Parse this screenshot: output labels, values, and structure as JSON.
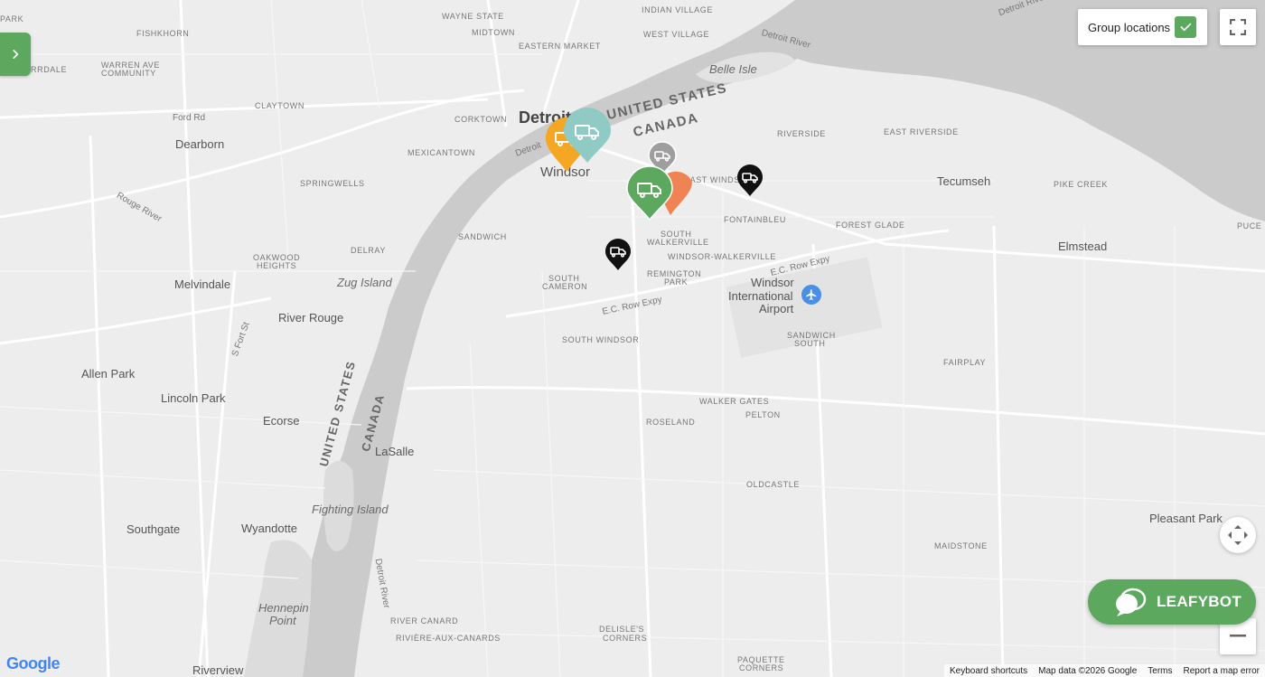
{
  "map": {
    "place_labels": [
      {
        "text": "PARK",
        "cls": "sm"
      },
      {
        "text": "WAYNE STATE",
        "cls": "sm"
      },
      {
        "text": "INDIAN VILLAGE",
        "cls": "sm"
      },
      {
        "text": "FISHKHORN",
        "cls": "sm"
      },
      {
        "text": "MIDTOWN",
        "cls": "sm"
      },
      {
        "text": "WEST VILLAGE",
        "cls": "sm"
      },
      {
        "text": "EASTERN MARKET",
        "cls": "sm"
      },
      {
        "text": "Belle Isle",
        "cls": "md it"
      },
      {
        "text": "RRDALE",
        "cls": "sm"
      },
      {
        "text": "WARREN AVE",
        "cls": "sm"
      },
      {
        "text": "COMMUNITY",
        "cls": "sm"
      },
      {
        "text": "CLAYTOWN",
        "cls": "sm"
      },
      {
        "text": "Ford Rd",
        "cls": "road"
      },
      {
        "text": "CORKTOWN",
        "cls": "sm"
      },
      {
        "text": "Detroit",
        "cls": "xl"
      },
      {
        "text": "Dearborn",
        "cls": "md"
      },
      {
        "text": "MEXICANTOWN",
        "cls": "sm"
      },
      {
        "text": "RIVERSIDE",
        "cls": "sm"
      },
      {
        "text": "EAST RIVERSIDE",
        "cls": "sm"
      },
      {
        "text": "Windsor",
        "cls": "lg"
      },
      {
        "text": "EAST WINDSOR",
        "cls": "sm"
      },
      {
        "text": "Tecumseh",
        "cls": "md"
      },
      {
        "text": "PIKE CREEK",
        "cls": "sm"
      },
      {
        "text": "SPRINGWELLS",
        "cls": "sm"
      },
      {
        "text": "FONTAINBLEU",
        "cls": "sm"
      },
      {
        "text": "FOREST GLADE",
        "cls": "sm"
      },
      {
        "text": "PUCE",
        "cls": "sm"
      },
      {
        "text": "SANDWICH",
        "cls": "sm"
      },
      {
        "text": "SOUTH",
        "cls": "sm"
      },
      {
        "text": "WALKERVILLE",
        "cls": "sm"
      },
      {
        "text": "Elmstead",
        "cls": "md"
      },
      {
        "text": "DELRAY",
        "cls": "sm"
      },
      {
        "text": "WINDSOR-WALKERVILLE",
        "cls": "sm"
      },
      {
        "text": "OAKWOOD",
        "cls": "sm"
      },
      {
        "text": "HEIGHTS",
        "cls": "sm"
      },
      {
        "text": "Zug Island",
        "cls": "md it"
      },
      {
        "text": "Melvindale",
        "cls": "md"
      },
      {
        "text": "REMINGTON",
        "cls": "sm"
      },
      {
        "text": "PARK",
        "cls": "sm"
      },
      {
        "text": "SOUTH",
        "cls": "sm"
      },
      {
        "text": "CAMERON",
        "cls": "sm"
      },
      {
        "text": "Windsor",
        "cls": "md"
      },
      {
        "text": "International",
        "cls": "md"
      },
      {
        "text": "Airport",
        "cls": "md"
      },
      {
        "text": "River Rouge",
        "cls": "md"
      },
      {
        "text": "SANDWICH",
        "cls": "sm"
      },
      {
        "text": "SOUTH",
        "cls": "sm"
      },
      {
        "text": "SOUTH WINDSOR",
        "cls": "sm"
      },
      {
        "text": "Allen Park",
        "cls": "md"
      },
      {
        "text": "FAIRPLAY",
        "cls": "sm"
      },
      {
        "text": "Lincoln Park",
        "cls": "md"
      },
      {
        "text": "WALKER GATES",
        "cls": "sm"
      },
      {
        "text": "PELTON",
        "cls": "sm"
      },
      {
        "text": "Ecorse",
        "cls": "md"
      },
      {
        "text": "ROSELAND",
        "cls": "sm"
      },
      {
        "text": "LaSalle",
        "cls": "md"
      },
      {
        "text": "OLDCASTLE",
        "cls": "sm"
      },
      {
        "text": "Fighting Island",
        "cls": "md it"
      },
      {
        "text": "Southgate",
        "cls": "md"
      },
      {
        "text": "Wyandotte",
        "cls": "md"
      },
      {
        "text": "Pleasant Park",
        "cls": "md"
      },
      {
        "text": "MAIDSTONE",
        "cls": "sm"
      },
      {
        "text": "Hennepin",
        "cls": "md it"
      },
      {
        "text": "Point",
        "cls": "md it"
      },
      {
        "text": "RIVER CANARD",
        "cls": "sm"
      },
      {
        "text": "DELISLE'S",
        "cls": "sm"
      },
      {
        "text": "CORNERS",
        "cls": "sm"
      },
      {
        "text": "RIVIÈRE-AUX-CANARDS",
        "cls": "sm"
      },
      {
        "text": "PAQUETTE",
        "cls": "sm"
      },
      {
        "text": "CORNERS",
        "cls": "sm"
      },
      {
        "text": "Riverview",
        "cls": "md"
      },
      {
        "text": "E.C. Row Expy",
        "cls": "road"
      },
      {
        "text": "E.C. Row Expy",
        "cls": "road"
      },
      {
        "text": "S Fort St",
        "cls": "road"
      },
      {
        "text": "Rouge River",
        "cls": "road"
      },
      {
        "text": "Detroit River",
        "cls": "road"
      },
      {
        "text": "Detroit River",
        "cls": "road"
      },
      {
        "text": "Detroit",
        "cls": "road"
      },
      {
        "text": "Detroit River",
        "cls": "road"
      }
    ],
    "border_labels": [
      "UNITED STATES",
      "CANADA",
      "UNITED STATES",
      "CANADA"
    ],
    "markers": [
      {
        "name": "vehicle-marker-orange",
        "color": "#f5a623"
      },
      {
        "name": "vehicle-marker-teal",
        "color": "#8fcac4"
      },
      {
        "name": "vehicle-marker-gray",
        "color": "#9e9e9e"
      },
      {
        "name": "vehicle-marker-coral",
        "color": "#ef8354"
      },
      {
        "name": "vehicle-marker-green",
        "color": "#5ca85f"
      },
      {
        "name": "vehicle-marker-black-east",
        "color": "#111111"
      },
      {
        "name": "vehicle-marker-black-south",
        "color": "#111111"
      }
    ]
  },
  "controls": {
    "group_locations_label": "Group locations",
    "group_locations_checked": true,
    "leafybot_label": "LEAFYBOT",
    "brand_color": "#5ca85f"
  },
  "attribution": {
    "google_logo": "Google",
    "keyboard_shortcuts": "Keyboard shortcuts",
    "map_data": "Map data ©2026 Google",
    "terms": "Terms",
    "report": "Report a map error"
  }
}
